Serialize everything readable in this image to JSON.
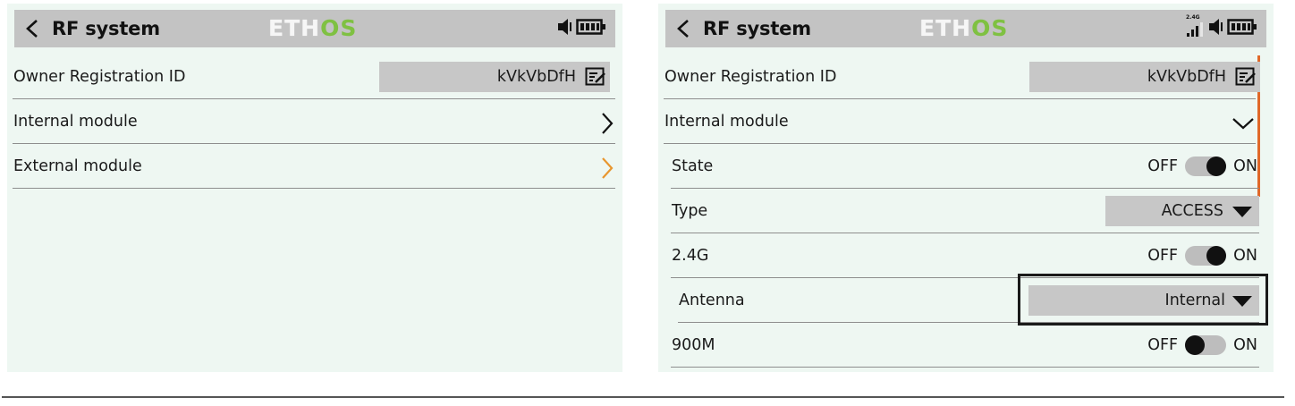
{
  "left_screen": {
    "header": {
      "title": "RF system",
      "logo_eth": "ETH",
      "logo_os": "OS"
    },
    "rows": [
      {
        "label": "Owner Registration ID",
        "value": "kVkVbDfH"
      },
      {
        "label": "Internal module"
      },
      {
        "label": "External module"
      }
    ]
  },
  "right_screen": {
    "header": {
      "title": "RF system",
      "logo_eth": "ETH",
      "logo_os": "OS",
      "signal_band": "2.4G"
    },
    "rows": {
      "owner_id": {
        "label": "Owner Registration ID",
        "value": "kVkVbDfH"
      },
      "internal_module": {
        "label": "Internal module"
      },
      "state": {
        "label": "State",
        "off": "OFF",
        "on": "ON",
        "enabled": true
      },
      "type": {
        "label": "Type",
        "value": "ACCESS"
      },
      "band_24g": {
        "label": "2.4G",
        "off": "OFF",
        "on": "ON",
        "enabled": true
      },
      "antenna": {
        "label": "Antenna",
        "value": "Internal"
      },
      "band_900m": {
        "label": "900M",
        "off": "OFF",
        "on": "ON",
        "enabled": false
      }
    }
  },
  "colors": {
    "screen_bg": "#eef7f2",
    "header_bg": "#c3c3c3",
    "field_bg": "#c7c7c7",
    "accent_orange": "#e8962f",
    "scroll_orange": "#e0692a",
    "logo_green": "#7fc142"
  },
  "icons": [
    "back-chevron-icon",
    "speaker-icon",
    "battery-icon",
    "signal-bars-icon",
    "edit-icon",
    "chevron-right-icon",
    "chevron-down-icon",
    "dropdown-triangle-icon"
  ]
}
